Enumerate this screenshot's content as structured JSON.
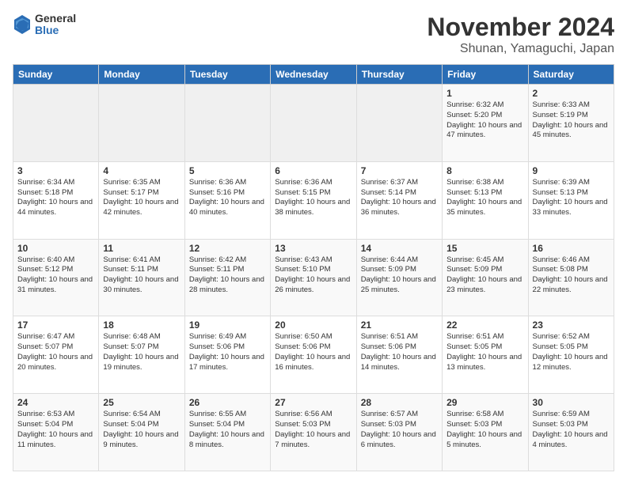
{
  "logo": {
    "general": "General",
    "blue": "Blue"
  },
  "title": "November 2024",
  "location": "Shunan, Yamaguchi, Japan",
  "days_header": [
    "Sunday",
    "Monday",
    "Tuesday",
    "Wednesday",
    "Thursday",
    "Friday",
    "Saturday"
  ],
  "weeks": [
    [
      {
        "num": "",
        "info": ""
      },
      {
        "num": "",
        "info": ""
      },
      {
        "num": "",
        "info": ""
      },
      {
        "num": "",
        "info": ""
      },
      {
        "num": "",
        "info": ""
      },
      {
        "num": "1",
        "info": "Sunrise: 6:32 AM\nSunset: 5:20 PM\nDaylight: 10 hours and 47 minutes."
      },
      {
        "num": "2",
        "info": "Sunrise: 6:33 AM\nSunset: 5:19 PM\nDaylight: 10 hours and 45 minutes."
      }
    ],
    [
      {
        "num": "3",
        "info": "Sunrise: 6:34 AM\nSunset: 5:18 PM\nDaylight: 10 hours and 44 minutes."
      },
      {
        "num": "4",
        "info": "Sunrise: 6:35 AM\nSunset: 5:17 PM\nDaylight: 10 hours and 42 minutes."
      },
      {
        "num": "5",
        "info": "Sunrise: 6:36 AM\nSunset: 5:16 PM\nDaylight: 10 hours and 40 minutes."
      },
      {
        "num": "6",
        "info": "Sunrise: 6:36 AM\nSunset: 5:15 PM\nDaylight: 10 hours and 38 minutes."
      },
      {
        "num": "7",
        "info": "Sunrise: 6:37 AM\nSunset: 5:14 PM\nDaylight: 10 hours and 36 minutes."
      },
      {
        "num": "8",
        "info": "Sunrise: 6:38 AM\nSunset: 5:13 PM\nDaylight: 10 hours and 35 minutes."
      },
      {
        "num": "9",
        "info": "Sunrise: 6:39 AM\nSunset: 5:13 PM\nDaylight: 10 hours and 33 minutes."
      }
    ],
    [
      {
        "num": "10",
        "info": "Sunrise: 6:40 AM\nSunset: 5:12 PM\nDaylight: 10 hours and 31 minutes."
      },
      {
        "num": "11",
        "info": "Sunrise: 6:41 AM\nSunset: 5:11 PM\nDaylight: 10 hours and 30 minutes."
      },
      {
        "num": "12",
        "info": "Sunrise: 6:42 AM\nSunset: 5:11 PM\nDaylight: 10 hours and 28 minutes."
      },
      {
        "num": "13",
        "info": "Sunrise: 6:43 AM\nSunset: 5:10 PM\nDaylight: 10 hours and 26 minutes."
      },
      {
        "num": "14",
        "info": "Sunrise: 6:44 AM\nSunset: 5:09 PM\nDaylight: 10 hours and 25 minutes."
      },
      {
        "num": "15",
        "info": "Sunrise: 6:45 AM\nSunset: 5:09 PM\nDaylight: 10 hours and 23 minutes."
      },
      {
        "num": "16",
        "info": "Sunrise: 6:46 AM\nSunset: 5:08 PM\nDaylight: 10 hours and 22 minutes."
      }
    ],
    [
      {
        "num": "17",
        "info": "Sunrise: 6:47 AM\nSunset: 5:07 PM\nDaylight: 10 hours and 20 minutes."
      },
      {
        "num": "18",
        "info": "Sunrise: 6:48 AM\nSunset: 5:07 PM\nDaylight: 10 hours and 19 minutes."
      },
      {
        "num": "19",
        "info": "Sunrise: 6:49 AM\nSunset: 5:06 PM\nDaylight: 10 hours and 17 minutes."
      },
      {
        "num": "20",
        "info": "Sunrise: 6:50 AM\nSunset: 5:06 PM\nDaylight: 10 hours and 16 minutes."
      },
      {
        "num": "21",
        "info": "Sunrise: 6:51 AM\nSunset: 5:06 PM\nDaylight: 10 hours and 14 minutes."
      },
      {
        "num": "22",
        "info": "Sunrise: 6:51 AM\nSunset: 5:05 PM\nDaylight: 10 hours and 13 minutes."
      },
      {
        "num": "23",
        "info": "Sunrise: 6:52 AM\nSunset: 5:05 PM\nDaylight: 10 hours and 12 minutes."
      }
    ],
    [
      {
        "num": "24",
        "info": "Sunrise: 6:53 AM\nSunset: 5:04 PM\nDaylight: 10 hours and 11 minutes."
      },
      {
        "num": "25",
        "info": "Sunrise: 6:54 AM\nSunset: 5:04 PM\nDaylight: 10 hours and 9 minutes."
      },
      {
        "num": "26",
        "info": "Sunrise: 6:55 AM\nSunset: 5:04 PM\nDaylight: 10 hours and 8 minutes."
      },
      {
        "num": "27",
        "info": "Sunrise: 6:56 AM\nSunset: 5:03 PM\nDaylight: 10 hours and 7 minutes."
      },
      {
        "num": "28",
        "info": "Sunrise: 6:57 AM\nSunset: 5:03 PM\nDaylight: 10 hours and 6 minutes."
      },
      {
        "num": "29",
        "info": "Sunrise: 6:58 AM\nSunset: 5:03 PM\nDaylight: 10 hours and 5 minutes."
      },
      {
        "num": "30",
        "info": "Sunrise: 6:59 AM\nSunset: 5:03 PM\nDaylight: 10 hours and 4 minutes."
      }
    ]
  ]
}
